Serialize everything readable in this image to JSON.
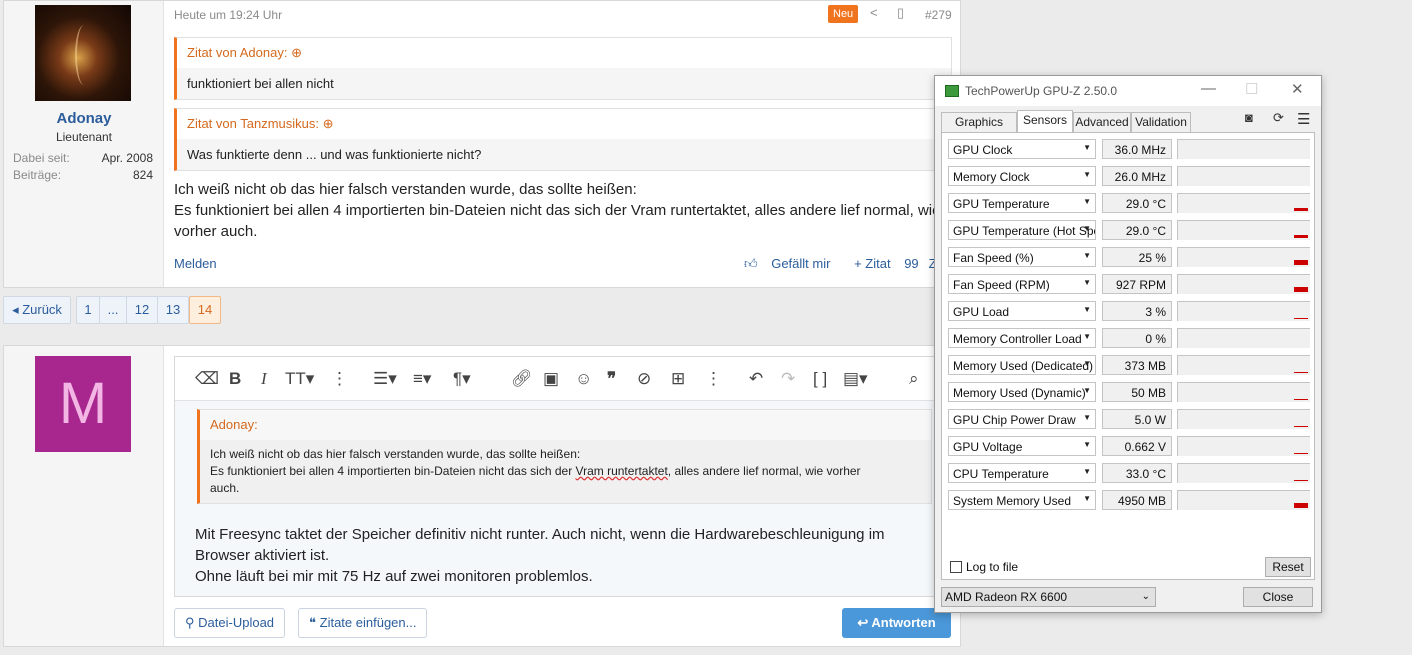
{
  "post": {
    "username": "Adonay",
    "rank": "Lieutenant",
    "stats": [
      {
        "label": "Dabei seit:",
        "value": "Apr. 2008"
      },
      {
        "label": "Beiträge:",
        "value": "824"
      }
    ],
    "timestamp": "Heute um 19:24 Uhr",
    "badge": "Neu",
    "number": "#279",
    "quotes": [
      {
        "header": "Zitat von Adonay:",
        "text": "funktioniert bei allen nicht"
      },
      {
        "header": "Zitat von Tanzmusikus:",
        "text": "Was funktierte denn ... und was funktionierte nicht?"
      }
    ],
    "body_lines": [
      "Ich weiß nicht ob das hier falsch verstanden wurde, das sollte heißen:",
      "Es funktioniert bei allen 4 importierten bin-Dateien nicht das sich der Vram runtertaktet, alles andere lief normal, wie",
      "vorher auch."
    ],
    "report": "Melden",
    "actions": {
      "like": "Gefällt mir",
      "quote": "+ Zitat",
      "cite": "Zitier"
    }
  },
  "pagination": {
    "prev": "◂ Zurück",
    "pages": [
      "1",
      "...",
      "12",
      "13",
      "14"
    ],
    "current": "14"
  },
  "reply": {
    "avatar_letter": "M",
    "quote_header": "Adonay:",
    "quote_lines": [
      "Ich weiß nicht ob das hier falsch verstanden wurde, das sollte heißen:",
      "Es funktioniert bei allen 4 importierten bin-Dateien nicht das sich der ",
      "Vram runtertaktet",
      ", alles andere lief normal, wie vorher",
      "auch."
    ],
    "text_lines": [
      "Mit Freesync taktet der Speicher definitiv nicht runter. Auch nicht, wenn die Hardwarebeschleunigung im",
      "Browser aktiviert ist.",
      "Ohne läuft bei mir mit 75 Hz auf zwei monitoren problemlos."
    ],
    "upload_label": "Datei-Upload",
    "insert_quotes_label": "Zitate einfügen...",
    "submit_label": "Antworten"
  },
  "gpuz": {
    "title": "TechPowerUp GPU-Z 2.50.0",
    "tabs": [
      "Graphics Card",
      "Sensors",
      "Advanced",
      "Validation"
    ],
    "active_tab": "Sensors",
    "sensors": [
      {
        "name": "GPU Clock",
        "value": "36.0 MHz",
        "level": 0
      },
      {
        "name": "Memory Clock",
        "value": "26.0 MHz",
        "level": 0
      },
      {
        "name": "GPU Temperature",
        "value": "29.0 °C",
        "level": 0.15
      },
      {
        "name": "GPU Temperature (Hot Spot)",
        "value": "29.0 °C",
        "level": 0.15
      },
      {
        "name": "Fan Speed (%)",
        "value": "25 %",
        "level": 0.25
      },
      {
        "name": "Fan Speed (RPM)",
        "value": "927 RPM",
        "level": 0.3
      },
      {
        "name": "GPU Load",
        "value": "3 %",
        "level": 0.03
      },
      {
        "name": "Memory Controller Load",
        "value": "0 %",
        "level": 0
      },
      {
        "name": "Memory Used (Dedicated)",
        "value": "373 MB",
        "level": 0.05
      },
      {
        "name": "Memory Used (Dynamic)",
        "value": "50 MB",
        "level": 0.05
      },
      {
        "name": "GPU Chip Power Draw",
        "value": "5.0 W",
        "level": 0.05
      },
      {
        "name": "GPU Voltage",
        "value": "0.662 V",
        "level": 0.05
      },
      {
        "name": "CPU Temperature",
        "value": "33.0 °C",
        "level": 0.05
      },
      {
        "name": "System Memory Used",
        "value": "4950 MB",
        "level": 0.25
      }
    ],
    "log_label": "Log to file",
    "reset_label": "Reset",
    "device": "AMD Radeon RX 6600",
    "close_label": "Close",
    "accent": "#cc0000"
  }
}
